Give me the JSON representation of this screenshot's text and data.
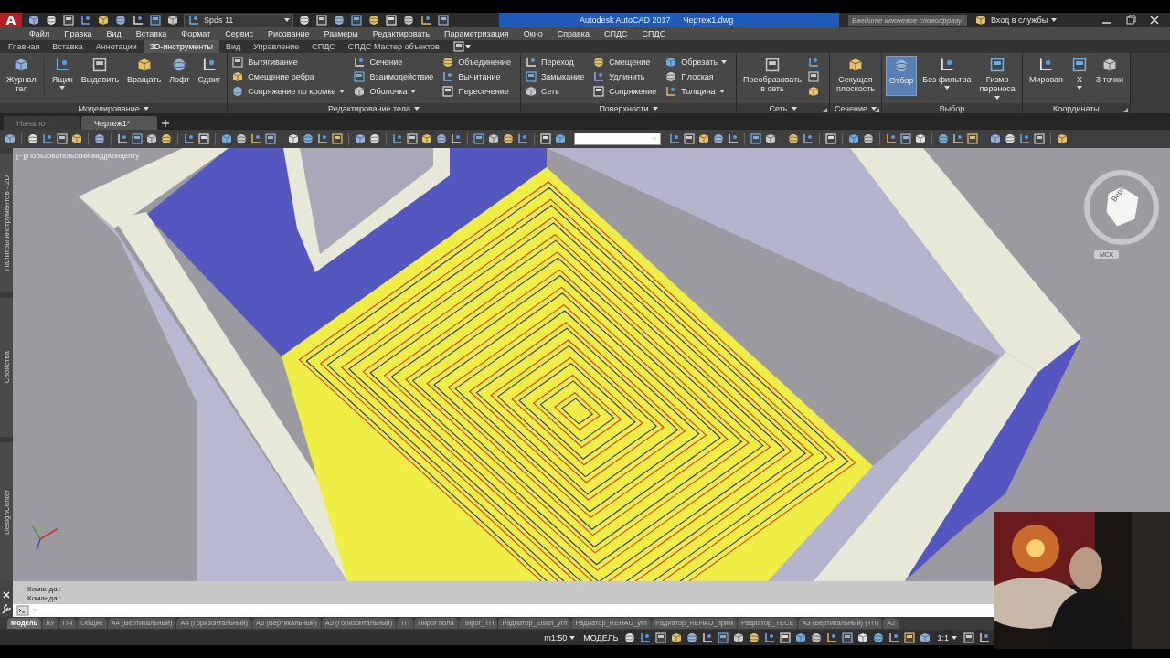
{
  "title_bar": {
    "logo": "A",
    "workspace": "Spds 11",
    "title": "Autodesk AutoCAD 2017",
    "file": "Чертеж1.dwg",
    "search": {
      "placeholder": "Введите ключевое слово/фразу"
    },
    "sign_in": "Вход в службы"
  },
  "menu": [
    "Файл",
    "Правка",
    "Вид",
    "Вставка",
    "Формат",
    "Сервис",
    "Рисование",
    "Размеры",
    "Редактировать",
    "Параметризация",
    "Окно",
    "Справка",
    "СПДС",
    "СПДС"
  ],
  "ribbon_tabs": [
    {
      "label": "Главная",
      "selected": false
    },
    {
      "label": "Вставка",
      "selected": false
    },
    {
      "label": "Аннотации",
      "selected": false
    },
    {
      "label": "3D-инструменты",
      "selected": true
    },
    {
      "label": "Вид",
      "selected": false
    },
    {
      "label": "Управление",
      "selected": false
    },
    {
      "label": "СПДС",
      "selected": false
    },
    {
      "label": "СПДС Мастер объектов",
      "selected": false
    }
  ],
  "ribbon_panels": [
    {
      "title": "Моделирование",
      "dropdown": true,
      "launcher": false,
      "items": [
        {
          "kind": "large",
          "label": "Журнал\nтел",
          "caret": false,
          "selected": false
        },
        {
          "kind": "separator"
        },
        {
          "kind": "large",
          "label": "Ящик",
          "caret": true,
          "selected": false
        },
        {
          "kind": "large",
          "label": "Выдавить",
          "caret": false,
          "selected": false
        },
        {
          "kind": "large",
          "label": "Вращать",
          "caret": false,
          "selected": false
        },
        {
          "kind": "large",
          "label": "Лофт",
          "caret": false,
          "selected": false
        },
        {
          "kind": "large",
          "label": "Сдвиг",
          "caret": false,
          "selected": false
        }
      ]
    },
    {
      "title": "Редактирование тела",
      "dropdown": true,
      "launcher": false,
      "items": [
        {
          "kind": "small",
          "label": "Вытягивание",
          "caret": false
        },
        {
          "kind": "small",
          "label": "Смещение ребра",
          "caret": false
        },
        {
          "kind": "small",
          "label": "Сопряжение по кромке",
          "caret": true
        },
        {
          "kind": "small",
          "label": "Сечение",
          "caret": false
        },
        {
          "kind": "small",
          "label": "Взаимодействие",
          "caret": false
        },
        {
          "kind": "small",
          "label": "Оболочка",
          "caret": true
        },
        {
          "kind": "small",
          "label": "Объединение",
          "caret": false
        },
        {
          "kind": "small",
          "label": "Вычитание",
          "caret": false
        },
        {
          "kind": "small",
          "label": "Пересечение",
          "caret": false
        }
      ]
    },
    {
      "title": "Поверхности",
      "dropdown": true,
      "launcher": false,
      "items": [
        {
          "kind": "small",
          "label": "Переход",
          "caret": false
        },
        {
          "kind": "small",
          "label": "Замыкание",
          "caret": false
        },
        {
          "kind": "small",
          "label": "Сеть",
          "caret": false
        },
        {
          "kind": "small",
          "label": "Смещение",
          "caret": false
        },
        {
          "kind": "small",
          "label": "Удлинить",
          "caret": false
        },
        {
          "kind": "small",
          "label": "Сопряжение",
          "caret": false
        },
        {
          "kind": "small",
          "label": "Обрезать",
          "caret": true
        },
        {
          "kind": "small",
          "label": "Плоская",
          "caret": false
        },
        {
          "kind": "small",
          "label": "Толщина",
          "caret": true
        }
      ]
    },
    {
      "title": "Сеть",
      "dropdown": true,
      "launcher": true,
      "items": [
        {
          "kind": "large",
          "label": "Преобразовать\nв сеть",
          "caret": false,
          "selected": false
        },
        {
          "kind": "icon"
        },
        {
          "kind": "icon"
        },
        {
          "kind": "icon"
        }
      ]
    },
    {
      "title": "Сечение",
      "dropdown": true,
      "launcher": true,
      "items": [
        {
          "kind": "large",
          "label": "Секущая\nплоскость",
          "caret": false,
          "selected": false
        }
      ]
    },
    {
      "title": "Выбор",
      "dropdown": false,
      "launcher": false,
      "items": [
        {
          "kind": "large",
          "label": "Отбор",
          "caret": false,
          "selected": true
        },
        {
          "kind": "large",
          "label": "Без фильтра",
          "caret": true,
          "selected": false
        },
        {
          "kind": "large",
          "label": "Гизмо\nпереноса",
          "caret": true,
          "selected": false
        }
      ]
    },
    {
      "title": "Координаты",
      "dropdown": false,
      "launcher": true,
      "items": [
        {
          "kind": "large",
          "label": "Мировая",
          "caret": false,
          "selected": false
        },
        {
          "kind": "large",
          "label": "X",
          "caret": true,
          "selected": false
        },
        {
          "kind": "large",
          "label": "3 точки",
          "caret": false,
          "selected": false
        }
      ]
    }
  ],
  "document_tabs": [
    {
      "label": "Начало",
      "selected": false
    },
    {
      "label": "Чертеж1*",
      "selected": true
    }
  ],
  "viewport": {
    "label": "[−][Пользовательский вид][Концепту",
    "viewcube": "Верх",
    "ucs": "МСК"
  },
  "palettes": [
    "Палитры инструментов - 2D",
    "Свойства",
    "DesignCenter"
  ],
  "command_history": [
    "Команда :",
    "Команда :"
  ],
  "layout_tabs": [
    {
      "label": "Модель",
      "selected": true
    },
    {
      "label": "ЛУ",
      "selected": false
    },
    {
      "label": "ПЧ",
      "selected": false
    },
    {
      "label": "Общие",
      "selected": false
    },
    {
      "label": "А4 (Вертикальный)",
      "selected": false
    },
    {
      "label": "А4 (Горизонтальный)",
      "selected": false
    },
    {
      "label": "А3 (Вертикальный)",
      "selected": false
    },
    {
      "label": "А3 (Горизонтальный)",
      "selected": false
    },
    {
      "label": "ТП",
      "selected": false
    },
    {
      "label": "Пирог пола",
      "selected": false
    },
    {
      "label": "Пирог_ТП",
      "selected": false
    },
    {
      "label": "Радиатор_Elsen_угл",
      "selected": false
    },
    {
      "label": "Радиатор_REHAU_угл",
      "selected": false
    },
    {
      "label": "Радиатор_REHAU_прям",
      "selected": false
    },
    {
      "label": "Радиатор_TECE",
      "selected": false
    },
    {
      "label": "А3 (Вертикальный) (ТП)",
      "selected": false
    },
    {
      "label": "А2",
      "selected": false
    }
  ],
  "status_bar": {
    "scale": "m1:50",
    "space": "МОДЕЛЬ",
    "annotation_scale": "1:1"
  },
  "webcam": {
    "kind": "picture"
  }
}
